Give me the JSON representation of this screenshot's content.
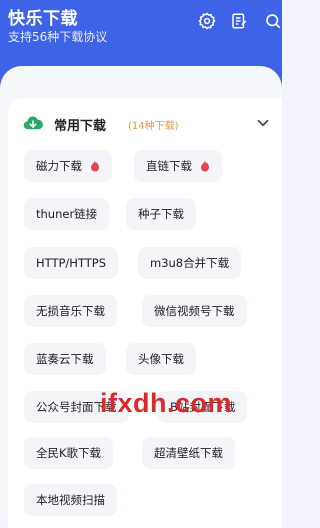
{
  "header": {
    "title": "快乐下载",
    "subtitle": "支持56种下载协议",
    "icons": [
      "gear-icon",
      "edit-note-icon",
      "search-icon"
    ],
    "accent_color": "#3e63e6"
  },
  "section": {
    "title": "常用下载",
    "count": "(14种下载)",
    "icon": "cloud-download-icon"
  },
  "chips": [
    {
      "label": "磁力下载",
      "hot": true
    },
    {
      "label": "直链下载",
      "hot": true
    },
    {
      "label": "thuner链接",
      "hot": false
    },
    {
      "label": "种子下载",
      "hot": false
    },
    {
      "label": "HTTP/HTTPS",
      "hot": false
    },
    {
      "label": "m3u8合并下载",
      "hot": false
    },
    {
      "label": "无损音乐下载",
      "hot": false
    },
    {
      "label": "微信视频号下载",
      "hot": false
    },
    {
      "label": "蓝奏云下载",
      "hot": false
    },
    {
      "label": "头像下载",
      "hot": false
    },
    {
      "label": "公众号封面下载",
      "hot": false
    },
    {
      "label": "B站封面下载",
      "hot": false
    },
    {
      "label": "全民K歌下载",
      "hot": false
    },
    {
      "label": "超清壁纸下载",
      "hot": false
    },
    {
      "label": "本地视频扫描",
      "hot": false
    }
  ],
  "watermark": "ifxdh.com"
}
